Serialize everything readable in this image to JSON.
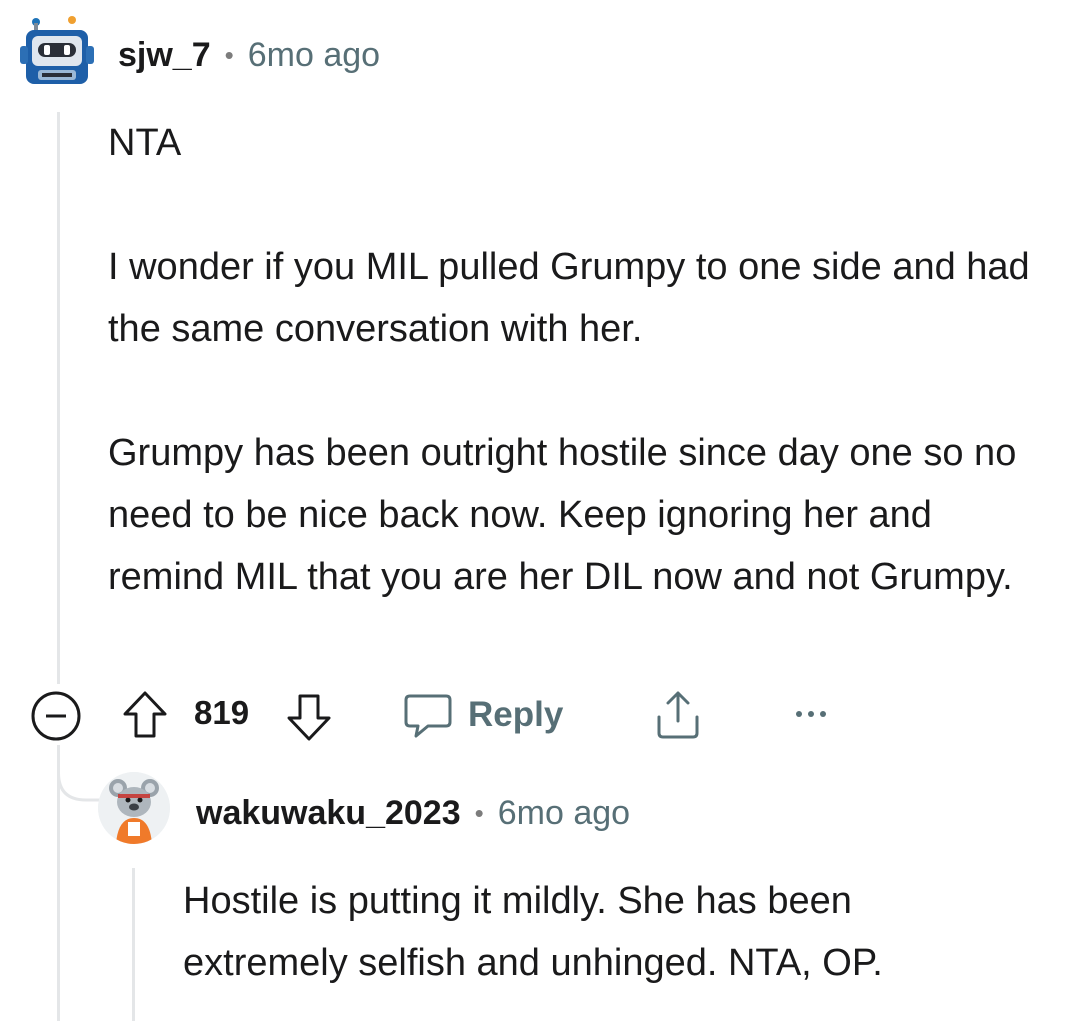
{
  "comment": {
    "username": "sjw_7",
    "separator": "•",
    "time": "6mo ago",
    "paragraphs": [
      "NTA",
      "I wonder if you MIL pulled Grumpy to one side and had the same conversation with her.",
      "Grumpy has been outright hostile since day one so no need to be nice back now. Keep ignoring her and remind MIL that you are her DIL now and not Grumpy."
    ],
    "actions": {
      "collapse_icon": "minus-circle-icon",
      "upvote_icon": "arrow-up-icon",
      "score": "819",
      "downvote_icon": "arrow-down-icon",
      "reply_icon": "chat-bubble-icon",
      "reply_label": "Reply",
      "share_icon": "share-icon",
      "more_icon": "ellipsis-icon"
    }
  },
  "reply": {
    "username": "wakuwaku_2023",
    "separator": "•",
    "time": "6mo ago",
    "paragraphs": [
      "Hostile is putting it mildly. She has been extremely selfish and unhinged. NTA, OP."
    ]
  },
  "colors": {
    "meta_gray": "#576f76",
    "thread_line": "#e4e6e8",
    "text": "#1a1a1b"
  }
}
